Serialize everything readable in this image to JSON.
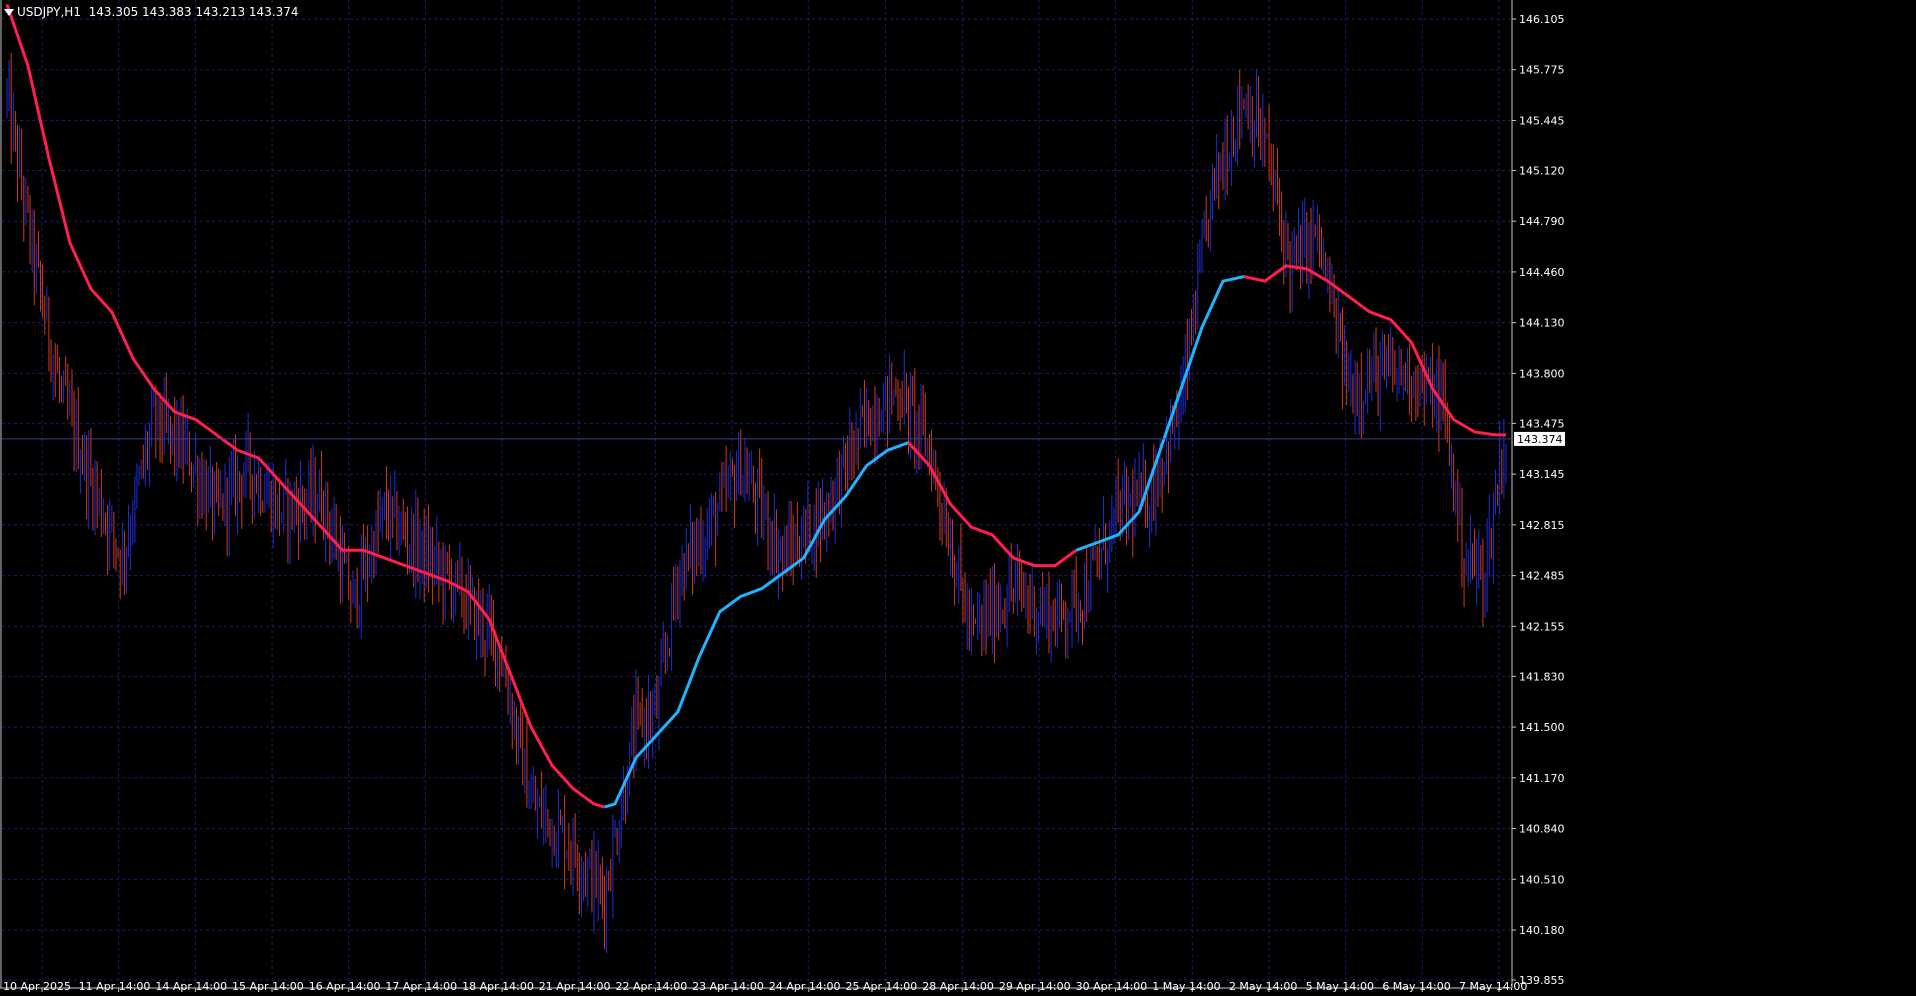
{
  "header": {
    "symbol": "USDJPY,H1",
    "ohlc": "143.305 143.383 143.213 143.374",
    "menu_icon": "triangle-down-icon"
  },
  "current_price": {
    "value": 143.374,
    "label": "143.374"
  },
  "colors": {
    "background": "#000000",
    "grid": "#1c1c6e",
    "axis": "#c8c8c8",
    "bar_up": "#1e2ed6",
    "bar_down": "#d23a1e",
    "ma_down": "#ff1e50",
    "ma_up": "#1eb4ff",
    "text": "#ffffff",
    "price_line": "#3c3c96"
  },
  "chart_data": {
    "type": "ohlc-bar",
    "title": "USDJPY,H1",
    "y_ticks": [
      146.105,
      145.775,
      145.445,
      145.12,
      144.79,
      144.46,
      144.13,
      143.8,
      143.475,
      143.145,
      142.815,
      142.485,
      142.155,
      141.83,
      141.5,
      141.17,
      140.84,
      140.51,
      140.18,
      139.855
    ],
    "y_tick_labels": [
      "146.105",
      "145.775",
      "145.445",
      "145.120",
      "144.790",
      "144.460",
      "144.130",
      "143.800",
      "143.475",
      "143.145",
      "142.815",
      "142.485",
      "142.155",
      "141.830",
      "141.500",
      "141.170",
      "140.840",
      "140.510",
      "140.180",
      "139.855"
    ],
    "ylim": [
      139.72,
      146.2
    ],
    "x_labels": [
      "10 Apr 2025",
      "11 Apr 14:00",
      "14 Apr 14:00",
      "15 Apr 14:00",
      "16 Apr 14:00",
      "17 Apr 14:00",
      "18 Apr 14:00",
      "21 Apr 14:00",
      "22 Apr 14:00",
      "23 Apr 14:00",
      "24 Apr 14:00",
      "25 Apr 14:00",
      "28 Apr 14:00",
      "29 Apr 14:00",
      "30 Apr 14:00",
      "1 May 14:00",
      "2 May 14:00",
      "5 May 14:00",
      "6 May 14:00",
      "7 May 14:00"
    ],
    "grid": true,
    "moving_average": {
      "name": "",
      "points": [
        [
          0,
          146.2
        ],
        [
          10,
          145.8
        ],
        [
          20,
          145.2
        ],
        [
          30,
          144.65
        ],
        [
          40,
          144.35
        ],
        [
          50,
          144.2
        ],
        [
          60,
          143.9
        ],
        [
          70,
          143.7
        ],
        [
          80,
          143.55
        ],
        [
          90,
          143.5
        ],
        [
          100,
          143.4
        ],
        [
          110,
          143.3
        ],
        [
          120,
          143.25
        ],
        [
          130,
          143.1
        ],
        [
          140,
          142.95
        ],
        [
          150,
          142.8
        ],
        [
          160,
          142.65
        ],
        [
          170,
          142.65
        ],
        [
          180,
          142.6
        ],
        [
          190,
          142.55
        ],
        [
          200,
          142.5
        ],
        [
          210,
          142.45
        ],
        [
          220,
          142.38
        ],
        [
          230,
          142.2
        ],
        [
          240,
          141.85
        ],
        [
          250,
          141.5
        ],
        [
          260,
          141.25
        ],
        [
          270,
          141.1
        ],
        [
          280,
          141.0
        ],
        [
          285,
          140.98
        ],
        [
          290,
          141.0
        ],
        [
          300,
          141.3
        ],
        [
          310,
          141.45
        ],
        [
          320,
          141.6
        ],
        [
          330,
          141.95
        ],
        [
          340,
          142.25
        ],
        [
          350,
          142.35
        ],
        [
          360,
          142.4
        ],
        [
          370,
          142.5
        ],
        [
          380,
          142.6
        ],
        [
          390,
          142.85
        ],
        [
          400,
          143.0
        ],
        [
          410,
          143.2
        ],
        [
          420,
          143.3
        ],
        [
          430,
          143.35
        ],
        [
          440,
          143.2
        ],
        [
          450,
          142.95
        ],
        [
          460,
          142.8
        ],
        [
          470,
          142.75
        ],
        [
          480,
          142.6
        ],
        [
          490,
          142.55
        ],
        [
          500,
          142.55
        ],
        [
          510,
          142.65
        ],
        [
          520,
          142.7
        ],
        [
          530,
          142.75
        ],
        [
          540,
          142.9
        ],
        [
          550,
          143.3
        ],
        [
          560,
          143.7
        ],
        [
          570,
          144.1
        ],
        [
          580,
          144.4
        ],
        [
          590,
          144.43
        ],
        [
          600,
          144.4
        ],
        [
          610,
          144.5
        ],
        [
          620,
          144.48
        ],
        [
          630,
          144.4
        ],
        [
          640,
          144.3
        ],
        [
          650,
          144.2
        ],
        [
          660,
          144.15
        ],
        [
          670,
          144.0
        ],
        [
          680,
          143.7
        ],
        [
          690,
          143.5
        ],
        [
          700,
          143.42
        ],
        [
          710,
          143.4
        ],
        [
          715,
          143.4
        ]
      ],
      "up_segments": [
        [
          285,
          430
        ],
        [
          510,
          590
        ]
      ]
    },
    "bars_count": 716,
    "bar_generation_note": ""
  }
}
